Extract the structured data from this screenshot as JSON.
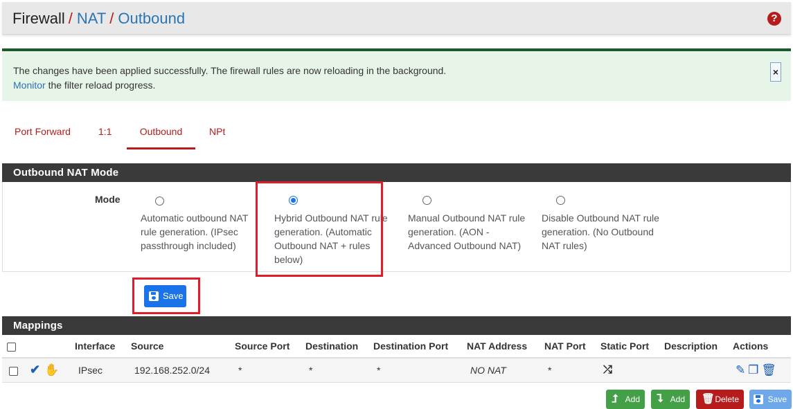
{
  "breadcrumb": {
    "items": [
      "Firewall",
      "NAT",
      "Outbound"
    ],
    "separator": "/"
  },
  "header": {
    "help_icon": "question-circle-icon"
  },
  "alert": {
    "line1": "The changes have been applied successfully. The firewall rules are now reloading in the background.",
    "link": "Monitor",
    "line2_rest": " the filter reload progress.",
    "close_label": "×"
  },
  "tabs": [
    {
      "label": "Port Forward",
      "active": false
    },
    {
      "label": "1:1",
      "active": false
    },
    {
      "label": "Outbound",
      "active": true
    },
    {
      "label": "NPt",
      "active": false
    }
  ],
  "mode_panel": {
    "title": "Outbound NAT Mode",
    "field_label": "Mode",
    "options": [
      {
        "text": "Automatic outbound NAT rule generation. (IPsec passthrough included)",
        "checked": false
      },
      {
        "text": "Hybrid Outbound NAT rule generation. (Automatic Outbound NAT + rules below)",
        "checked": true
      },
      {
        "text": "Manual Outbound NAT rule generation. (AON - Advanced Outbound NAT)",
        "checked": false
      },
      {
        "text": "Disable Outbound NAT rule generation. (No Outbound NAT rules)",
        "checked": false
      }
    ],
    "save_label": "Save"
  },
  "mappings": {
    "title": "Mappings",
    "columns": [
      "Interface",
      "Source",
      "Source Port",
      "Destination",
      "Destination Port",
      "NAT Address",
      "NAT Port",
      "Static Port",
      "Description",
      "Actions"
    ],
    "rows": [
      {
        "interface": "IPsec",
        "source": "192.168.252.0/24",
        "source_port": "*",
        "destination": "*",
        "destination_port": "*",
        "nat_address": "NO NAT",
        "nat_port": "*",
        "static_port": "shuffle-icon",
        "description": ""
      }
    ]
  },
  "footer_buttons": {
    "add_top": "Add",
    "add_bottom": "Add",
    "delete": "Delete",
    "save": "Save"
  },
  "colors": {
    "accent_red": "#b71c1c",
    "link_blue": "#2a74b5",
    "primary_blue": "#1a73e8",
    "success_green": "#43a047",
    "panel_dark": "#3a3a3a",
    "highlight_red": "#e21b2b"
  }
}
